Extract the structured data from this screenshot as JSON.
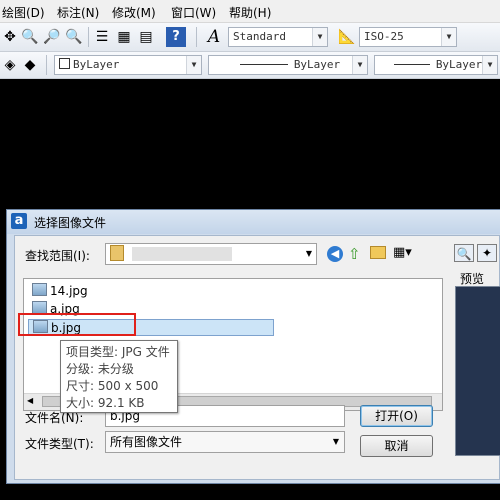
{
  "menubar": {
    "items": [
      "绘图(D)",
      "标注(N)",
      "修改(M)",
      "窗口(W)",
      "帮助(H)"
    ]
  },
  "toolbar": {
    "text_style": "Standard",
    "dim_style": "ISO-25",
    "layer": "ByLayer",
    "linetype": "ByLayer",
    "lineweight": "ByLayer"
  },
  "dialog": {
    "title": "选择图像文件",
    "app_icon_letter": "a",
    "lookin_label": "查找范围(I):",
    "files": [
      "14.jpg",
      "a.jpg",
      "b.jpg"
    ],
    "filename_label": "文件名(N):",
    "filename_value": "b.jpg",
    "filetype_label": "文件类型(T):",
    "filetype_value": "所有图像文件",
    "open_button": "打开(O)",
    "cancel_button": "取消",
    "preview_label": "预览"
  },
  "tooltip": {
    "type": "项目类型: JPG 文件",
    "rating": "分级: 未分级",
    "dimensions": "尺寸: 500 x 500",
    "size": "大小: 92.1 KB"
  },
  "colors": {
    "highlight_border": "#e0201a",
    "selection": "#cce4f7",
    "canvas": "#000000"
  }
}
